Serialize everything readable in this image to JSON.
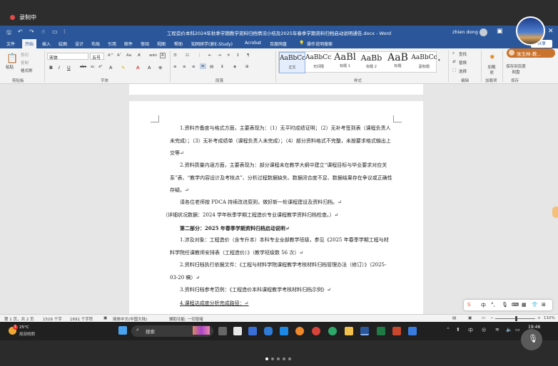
{
  "recording": {
    "label": "录制中"
  },
  "titlebar": {
    "title": "工程造价本科2024年秋季学期教学资料归档情况小结及2025年春季学期资料归档启动说明通告.docx - Word",
    "user": "zhien dong",
    "quick_access": [
      "save-icon",
      "undo-icon",
      "redo-icon",
      "touch-mode-icon",
      "customize-icon"
    ]
  },
  "menu": {
    "items": [
      "文件",
      "开始",
      "插入",
      "绘图",
      "设计",
      "布局",
      "引用",
      "邮件",
      "审阅",
      "视图",
      "帮助",
      "知网研学(原E-Study)",
      "Acrobat",
      "百度网盘"
    ],
    "active": "开始",
    "tell_me": "操作说明搜索",
    "share": "共享"
  },
  "ribbon": {
    "clipboard": {
      "paste": "粘贴",
      "cut": "剪切",
      "copy": "复制",
      "format_painter": "格式刷",
      "label": "剪贴板"
    },
    "font": {
      "name": "宋体",
      "size": "五号",
      "label": "字体"
    },
    "paragraph": {
      "label": "段落"
    },
    "styles": {
      "label": "样式",
      "items": [
        {
          "preview": "AaBbCcD",
          "name": "正文"
        },
        {
          "preview": "AaBbCcD",
          "name": "无间隔"
        },
        {
          "preview": "AaBl",
          "name": "标题 1"
        },
        {
          "preview": "AaBb",
          "name": "标题 2"
        },
        {
          "preview": "AaB",
          "name": "标题"
        },
        {
          "preview": "AaBbCc",
          "name": "副标题"
        }
      ]
    },
    "editing": {
      "find": "查找",
      "replace": "替换",
      "select": "选择",
      "label": "编辑"
    },
    "addins": {
      "load": "加载项",
      "label": "加载项"
    },
    "save": {
      "label": "保存到百度网盘",
      "group": "保存"
    }
  },
  "presenter": {
    "name": "张玉林-教..."
  },
  "document": {
    "paragraphs": [
      "1.资料齐备度与格式方面，主要表现为：（1）无平时成绩证明；（2）无补考签到表（课程负责人未完成）；（3）无补考成绩单（课程负责人未完成）；（4）部分资料格式不完整，未按要求格式输出上交等↵",
      "2.资料质量内涵方面，主要表现为：部分课程未在教学大纲中建立“课程目标与毕业要求对应关系”表、“教学内容设计及考核点”、分析过程数据缺失、数据闭合度不足、数据结果存在争议或正确性存疑。↵",
      "请各位老师按 PDCA 持续改进原则，做好新一轮课程建设及资料归档。↵",
      "（详细状况数据：2024 学年秋季学期工程造价专业课程教学资料归档检查。）↵",
      "第二部分：2025 年春季学期资料归档启动说明↵",
      "1.涉及对象：工程造价（含专升本）本科专业全部教学班级，参见《2025 年春季学期工程与材料学院任课教师安排表（工程造价）》（教学班级数 56 次）↵",
      "2.资料归档执行依据文件：《工程与材料学院课程教学考核材料归档管理办法（修订）》（2025-03-20 稿）↵",
      "3.资料归档参考范例：《工程造价本科课程教学考核材料归档示例》↵",
      "4.课程达成度分析完成路径：↵"
    ]
  },
  "statusbar": {
    "page": "第 1 页，共 2 页",
    "words": "1516 个字",
    "chars": "1691 个字符",
    "lang": "简体中文(中国大陆)",
    "accessibility": "辅助功能: 一切就绪",
    "zoom": "110%"
  },
  "ime": {
    "items": [
      "中",
      "°,",
      "mic",
      "keyboard",
      "apps",
      "skin",
      "grid",
      "more"
    ]
  },
  "taskbar": {
    "weather_temp": "25°C",
    "weather_desc": "局部晴朗",
    "weather_badge": "1",
    "search_placeholder": "搜索",
    "time": "19:46",
    "date": "2025/4/..."
  },
  "colors": {
    "word_blue": "#2b579a",
    "recording_red": "#e54b4b",
    "presenter_orange": "#c9732c"
  }
}
